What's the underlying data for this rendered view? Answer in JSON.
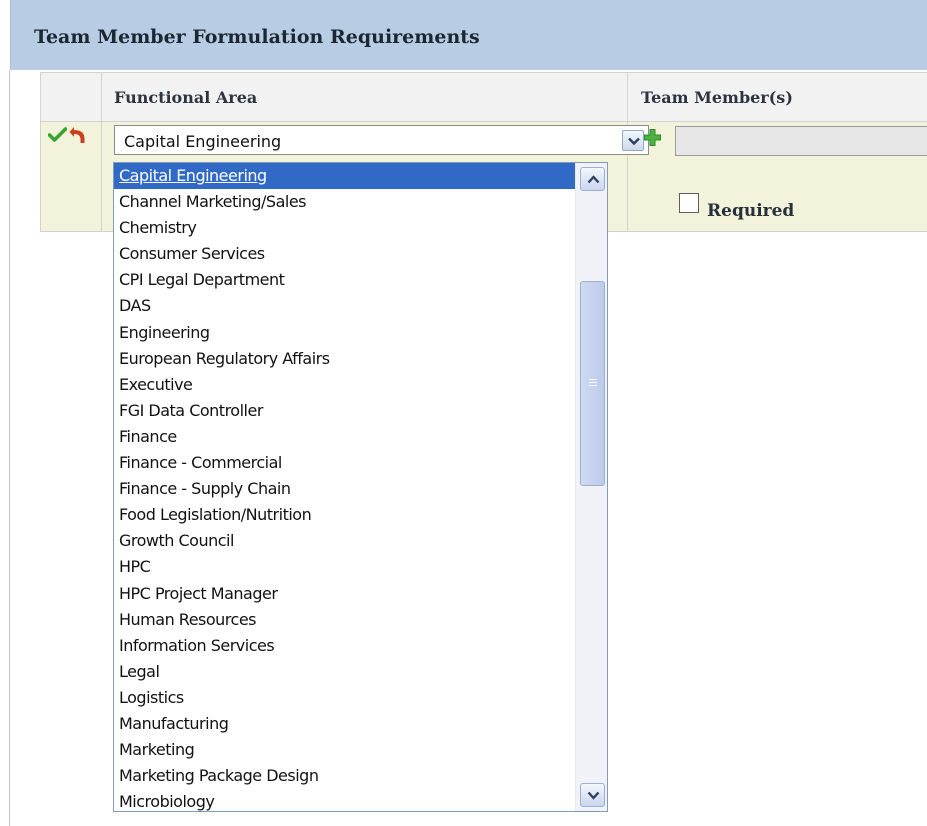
{
  "panel": {
    "title": "Team Member Formulation Requirements"
  },
  "grid": {
    "columns": [
      "Functional Area",
      "Team Member(s)"
    ],
    "row": {
      "functional_area_value": "Capital Engineering",
      "team_member_value": "",
      "required_label": "Required",
      "required_checked": false
    }
  },
  "icons": {
    "save": "check-icon",
    "undo": "undo-icon",
    "add": "plus-icon",
    "combo_arrow": "chevron-down-icon"
  },
  "colors": {
    "header_bg": "#b8cde4",
    "row_bg": "#f3f3dc",
    "selected_option_bg": "#3169c6",
    "check_green": "#3aa330",
    "undo_red": "#c9411c"
  },
  "dropdown": {
    "selected_index": 0,
    "options": [
      "Capital Engineering",
      "Channel Marketing/Sales",
      "Chemistry",
      "Consumer Services",
      "CPI Legal Department",
      "DAS",
      "Engineering",
      "European Regulatory Affairs",
      "Executive",
      "FGI Data Controller",
      "Finance",
      "Finance - Commercial",
      "Finance - Supply Chain",
      "Food Legislation/Nutrition",
      "Growth Council",
      "HPC",
      "HPC Project Manager",
      "Human Resources",
      "Information Services",
      "Legal",
      "Logistics",
      "Manufacturing",
      "Marketing",
      "Marketing Package Design",
      "Microbiology"
    ]
  }
}
